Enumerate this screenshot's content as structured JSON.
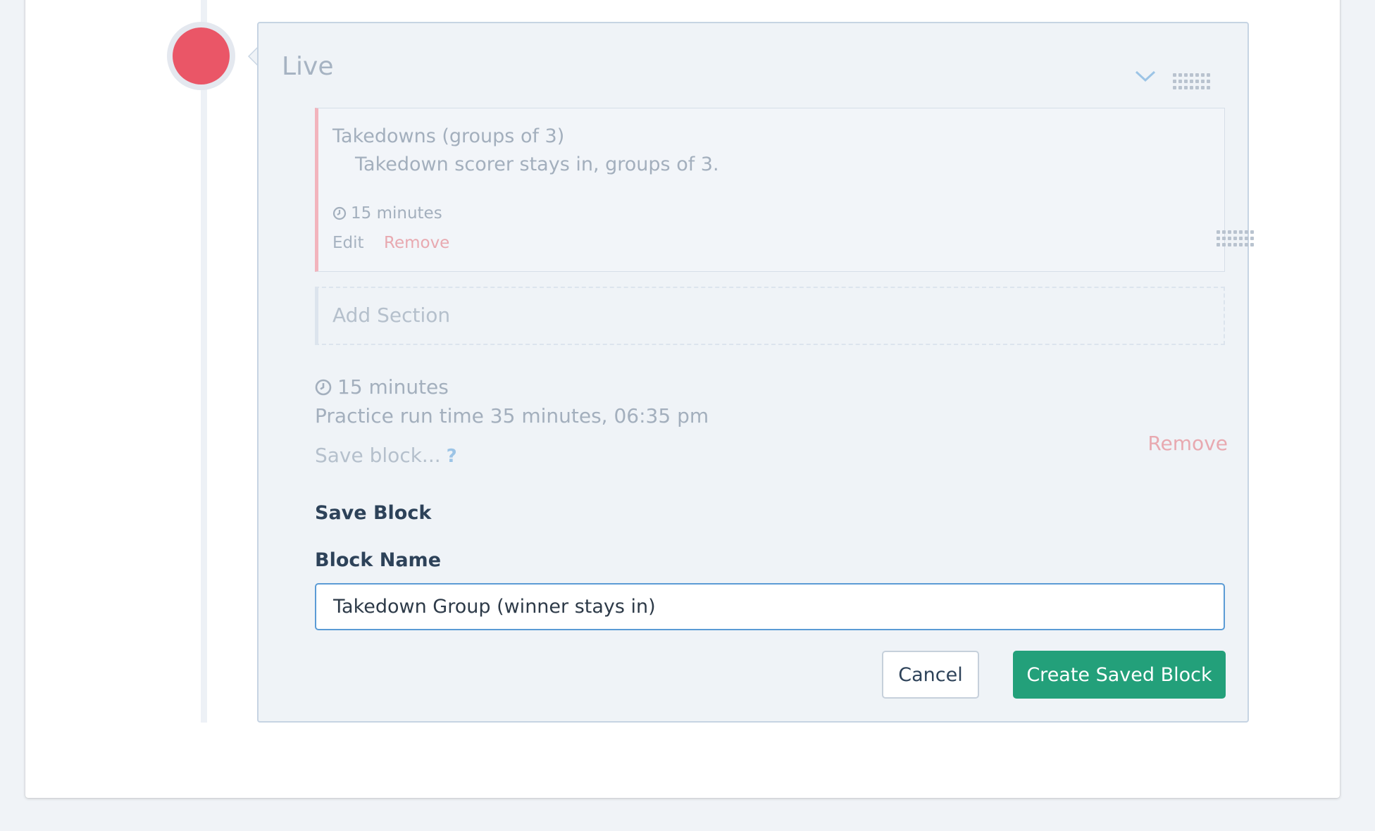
{
  "block": {
    "title": "Live",
    "section": {
      "title": "Takedowns (groups of 3)",
      "description": "Takedown scorer stays in, groups of 3.",
      "duration": "15 minutes",
      "edit_label": "Edit",
      "remove_label": "Remove"
    },
    "add_section_label": "Add Section",
    "duration": "15 minutes",
    "run_time": "Practice run time 35 minutes, 06:35 pm",
    "save_link_label": "Save block...",
    "help_label": "?",
    "remove_label": "Remove"
  },
  "save_form": {
    "heading": "Save Block",
    "name_label": "Block Name",
    "name_value": "Takedown Group (winner stays in)",
    "cancel_label": "Cancel",
    "create_label": "Create Saved Block"
  },
  "colors": {
    "timeline_dot": "#ea5667",
    "primary_button": "#23a07a",
    "remove_text": "#e8a9b0",
    "input_focus": "#5b9bd5"
  },
  "icons": [
    "chevron-down-icon",
    "drag-handle-icon",
    "clock-icon",
    "help-icon"
  ]
}
